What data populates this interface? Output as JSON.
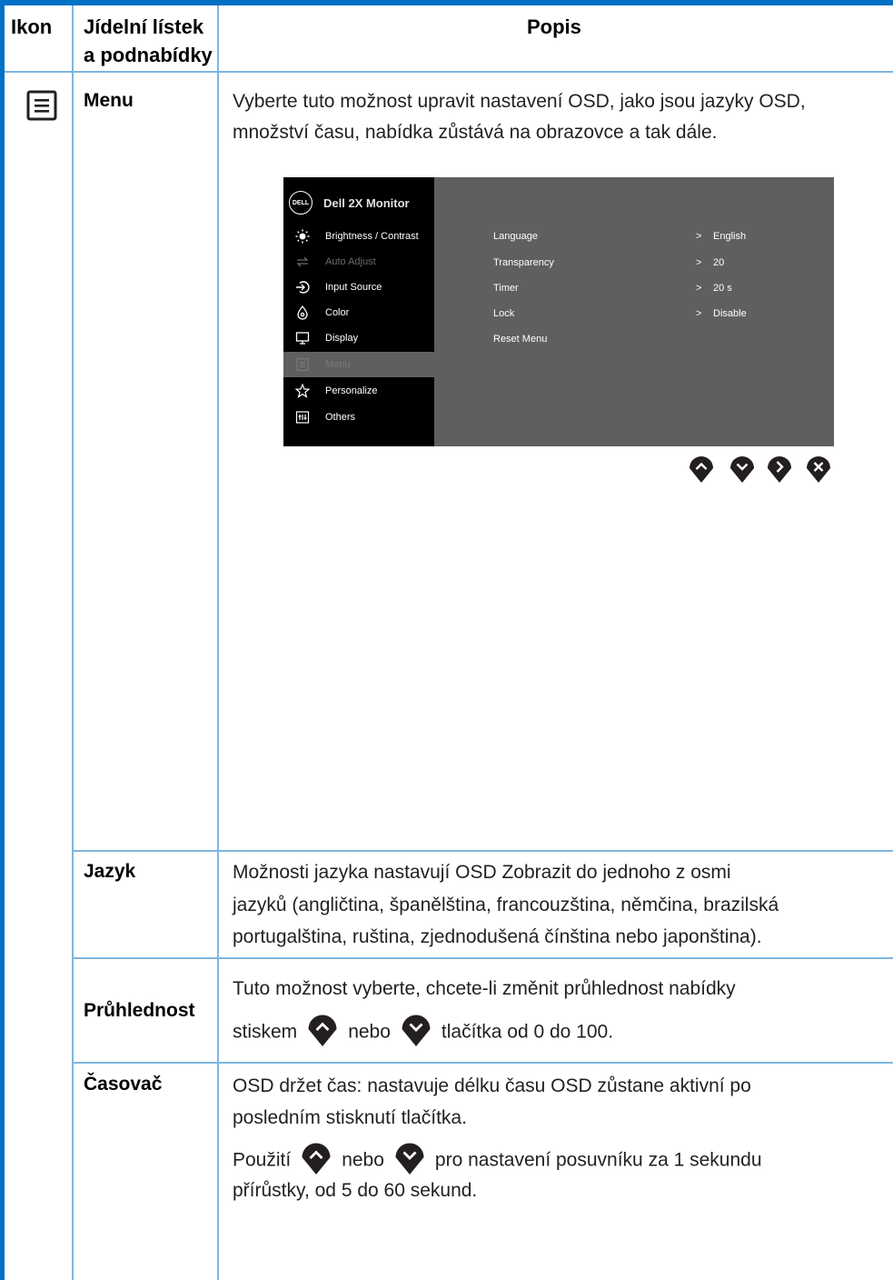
{
  "colors": {
    "accent": "#0071c5",
    "rule": "#7fb6e0",
    "osd_bg": "#5f5f5f",
    "osd_menu": "#000000"
  },
  "header": {
    "col_icon": "Ikon",
    "col_menu_line1": "Jídelní lístek",
    "col_menu_line2": "a podnabídky",
    "col_desc": "Popis"
  },
  "menu_row": {
    "icon": "menu-list-icon",
    "label": "Menu",
    "description_line1": "Vyberte tuto možnost upravit nastavení OSD, jako jsou jazyky OSD,",
    "description_line2": "množství času, nabídka zůstává na obrazovce a tak dále."
  },
  "osd": {
    "logo_text": "DELL",
    "title": "Dell 2X Monitor",
    "menu_items": [
      {
        "label": "Brightness / Contrast",
        "icon": "brightness-icon",
        "state": "normal"
      },
      {
        "label": "Auto Adjust",
        "icon": "auto-adjust-icon",
        "state": "disabled"
      },
      {
        "label": "Input Source",
        "icon": "input-source-icon",
        "state": "normal"
      },
      {
        "label": "Color",
        "icon": "color-icon",
        "state": "normal"
      },
      {
        "label": "Display",
        "icon": "display-icon",
        "state": "normal"
      },
      {
        "label": "Menu",
        "icon": "menu-icon",
        "state": "selected"
      },
      {
        "label": "Personalize",
        "icon": "star-icon",
        "state": "normal"
      },
      {
        "label": "Others",
        "icon": "others-icon",
        "state": "normal"
      }
    ],
    "settings": [
      {
        "name": "Language",
        "value": "English"
      },
      {
        "name": "Transparency",
        "value": "20"
      },
      {
        "name": "Timer",
        "value": "20 s"
      },
      {
        "name": "Lock",
        "value": "Disable"
      },
      {
        "name": "Reset Menu",
        "value": ""
      }
    ],
    "arrow": ">",
    "nav_buttons": [
      "up-button-icon",
      "down-button-icon",
      "right-button-icon",
      "close-button-icon"
    ]
  },
  "language_row": {
    "label": "Jazyk",
    "line1": "Možnosti jazyka nastavují OSD Zobrazit do jednoho z osmi",
    "line2": "jazyků (angličtina, španělština, francouzština, němčina, brazilská",
    "line3": "portugalština, ruština, zjednodušená čínština nebo japonština)."
  },
  "transparency_row": {
    "label": "Průhlednost",
    "line1": "Tuto možnost vyberte, chcete-li změnit průhlednost nabídky",
    "line2_a": "stiskem",
    "line2_b": "nebo",
    "line2_c": "tlačítka od 0 do 100."
  },
  "timer_row": {
    "label": "Časovač",
    "line1": "OSD držet čas: nastavuje délku času OSD zůstane aktivní po",
    "line2": "posledním stisknutí tlačítka.",
    "line3_a": "Použití",
    "line3_b": "nebo",
    "line3_c": "pro nastavení posuvníku za 1 sekundu",
    "line4": "přírůstky, od 5 do 60 sekund."
  }
}
